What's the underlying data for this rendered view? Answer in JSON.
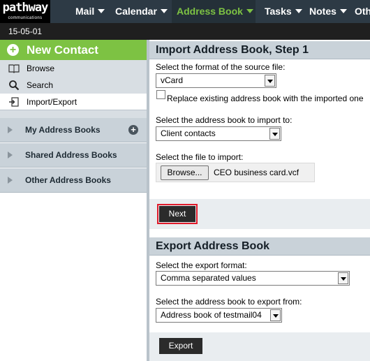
{
  "logo": {
    "word": "pathway",
    "sub": "communications"
  },
  "nav": {
    "tabs": [
      {
        "label": "Mail"
      },
      {
        "label": "Calendar"
      },
      {
        "label": "Address Book"
      },
      {
        "label": "Tasks"
      },
      {
        "label": "Notes"
      },
      {
        "label": "Oth"
      }
    ],
    "active_tab": "Address Book"
  },
  "date": "15-05-01",
  "sidebar": {
    "new_contact": "New Contact",
    "links": [
      {
        "label": "Browse",
        "icon": "book-icon"
      },
      {
        "label": "Search",
        "icon": "magnifier-icon"
      },
      {
        "label": "Import/Export",
        "icon": "import-export-icon"
      }
    ],
    "sections": [
      {
        "label": "My Address Books"
      },
      {
        "label": "Shared Address Books"
      },
      {
        "label": "Other Address Books"
      }
    ]
  },
  "import": {
    "title": "Import Address Book, Step 1",
    "format_label": "Select the format of the source file:",
    "format_value": "vCard",
    "replace_label": "Replace existing address book with the imported one",
    "replace_checked": false,
    "book_label": "Select the address book to import to:",
    "book_value": "Client contacts",
    "file_label": "Select the file to import:",
    "browse_label": "Browse...",
    "file_name": "CEO business card.vcf",
    "next_label": "Next"
  },
  "export": {
    "title": "Export Address Book",
    "format_label": "Select the export format:",
    "format_value": "Comma separated values",
    "book_label": "Select the address book to export from:",
    "book_value": "Address book of testmail04",
    "export_label": "Export"
  },
  "colors": {
    "nav_bg": "#2d3a45",
    "accent_green": "#7dc243",
    "highlight_red": "#e01b2b",
    "panel_header": "#c9d2d9"
  }
}
